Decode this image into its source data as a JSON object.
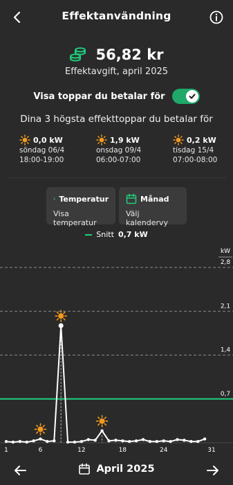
{
  "header": {
    "title": "Effektanvändning"
  },
  "summary": {
    "amount": "56,82 kr",
    "subtitle": "Effektavgift, april 2025"
  },
  "toggle": {
    "label": "Visa toppar du betalar för",
    "on": true
  },
  "peaks": {
    "heading": "Dina 3 högsta effekttoppar du betalar för",
    "items": [
      {
        "kw": "0,0 kW",
        "date": "söndag 06/4",
        "time": "18:00-19:00"
      },
      {
        "kw": "1,9 kW",
        "date": "onsdag 09/4",
        "time": "06:00-07:00"
      },
      {
        "kw": "0,2 kW",
        "date": "tisdag 15/4",
        "time": "07:00-08:00"
      }
    ]
  },
  "cards": {
    "temperature": {
      "title": "Temperatur",
      "subtitle": "Visa temperatur"
    },
    "month": {
      "title": "Månad",
      "subtitle": "Välj kalendervy"
    }
  },
  "legend": {
    "label": "Snitt",
    "value": "0,7 kW"
  },
  "colors": {
    "accent": "#1fcf7c",
    "sun": "#f39a1e",
    "background": "#2a2a2a"
  },
  "chart_data": {
    "type": "line",
    "unit": "kW",
    "x": [
      1,
      2,
      3,
      4,
      5,
      6,
      7,
      8,
      9,
      10,
      11,
      12,
      13,
      14,
      15,
      16,
      17,
      18,
      19,
      20,
      21,
      22,
      23,
      24,
      25,
      26,
      27,
      28,
      29,
      30
    ],
    "values": [
      0.02,
      0.01,
      0.02,
      0.01,
      0.03,
      0.06,
      0.02,
      0.03,
      1.87,
      0.01,
      0.01,
      0.02,
      0.05,
      0.04,
      0.19,
      0.03,
      0.04,
      0.03,
      0.02,
      0.03,
      0.05,
      0.02,
      0.02,
      0.03,
      0.02,
      0.05,
      0.04,
      0.02,
      0.02,
      0.06
    ],
    "x_ticks": [
      "1",
      "6",
      "12",
      "18",
      "24",
      "31"
    ],
    "y_ticks": [
      "0,7",
      "1,4",
      "2,1",
      "2,8"
    ],
    "ylim": [
      0,
      2.8
    ],
    "average": 0.7,
    "peak_days": [
      6,
      9,
      15
    ],
    "grid": true
  },
  "nav": {
    "month": "April 2025"
  }
}
